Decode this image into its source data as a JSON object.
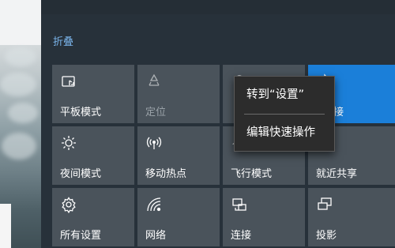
{
  "action_center": {
    "collapse_label": "折叠",
    "tiles": [
      {
        "label": "平板模式",
        "icon": "tablet-mode-icon",
        "state": "off"
      },
      {
        "label": "定位",
        "icon": "location-icon",
        "state": "dim"
      },
      {
        "label": "",
        "icon": "vpn-icon",
        "state": "off"
      },
      {
        "label": "接",
        "icon": "bluetooth-icon",
        "state": "on"
      },
      {
        "label": "夜间模式",
        "icon": "brightness-icon",
        "state": "off"
      },
      {
        "label": "移动热点",
        "icon": "mobile-hotspot-icon",
        "state": "off"
      },
      {
        "label": "飞行模式",
        "icon": "airplane-icon",
        "state": "off"
      },
      {
        "label": "就近共享",
        "icon": "nearby-share-icon",
        "state": "off"
      },
      {
        "label": "所有设置",
        "icon": "settings-gear-icon",
        "state": "off"
      },
      {
        "label": "网络",
        "icon": "network-icon",
        "state": "off"
      },
      {
        "label": "连接",
        "icon": "connect-icon",
        "state": "off"
      },
      {
        "label": "投影",
        "icon": "project-icon",
        "state": "off"
      }
    ]
  },
  "context_menu": {
    "items": [
      {
        "label": "转到“设置”"
      },
      {
        "label": "编辑快速操作"
      }
    ]
  },
  "colors": {
    "panel_bg": "#27313a",
    "tile_bg": "#4a535b",
    "tile_active_bg": "#1b7fd9",
    "link_accent": "#7ab4ea",
    "menu_bg": "#2c2c2c"
  }
}
